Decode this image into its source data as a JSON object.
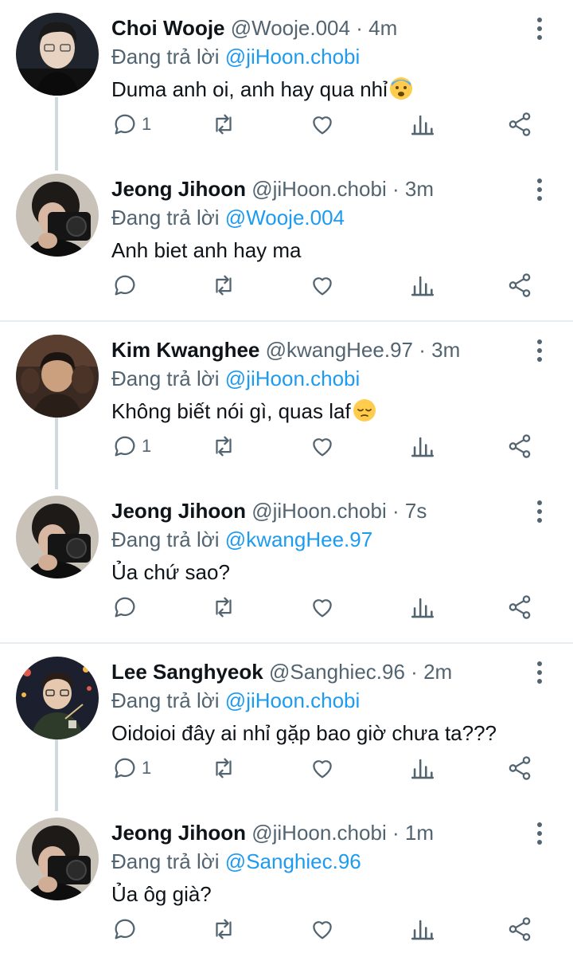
{
  "reply_prefix": "Đang trả lời",
  "separator": "·",
  "colors": {
    "accent": "#1d9bf0",
    "muted": "#536471",
    "text": "#0f1419",
    "thread_line": "#cfd9de"
  },
  "tweets": [
    {
      "name": "Choi Wooje",
      "handle": "@Wooje.004",
      "time": "4m",
      "reply_to": "@jiHoon.chobi",
      "text": "Duma anh oi, anh hay qua nhỉ",
      "emoji": "fearful-face-emoji",
      "reply_count": "1"
    },
    {
      "name": "Jeong Jihoon",
      "handle": "@jiHoon.chobi",
      "time": "3m",
      "reply_to": "@Wooje.004",
      "text": "Anh biet anh hay ma",
      "reply_count": ""
    },
    {
      "name": "Kim Kwanghee",
      "handle": "@kwangHee.97",
      "time": "3m",
      "reply_to": "@jiHoon.chobi",
      "text": "Không biết nói gì, quas laf",
      "emoji": "pensive-face-emoji",
      "reply_count": "1"
    },
    {
      "name": "Jeong Jihoon",
      "handle": "@jiHoon.chobi",
      "time": "7s",
      "reply_to": "@kwangHee.97",
      "text": "Ủa chứ sao?",
      "reply_count": ""
    },
    {
      "name": "Lee Sanghyeok",
      "handle": "@Sanghiec.96",
      "time": "2m",
      "reply_to": "@jiHoon.chobi",
      "text": "Oidoioi đây ai nhỉ gặp bao giờ chưa ta???",
      "reply_count": "1"
    },
    {
      "name": "Jeong Jihoon",
      "handle": "@jiHoon.chobi",
      "time": "1m",
      "reply_to": "@Sanghiec.96",
      "text": "Ủa ôg già?",
      "reply_count": ""
    }
  ],
  "icons": [
    "reply-icon",
    "retweet-icon",
    "like-icon",
    "analytics-icon",
    "share-icon",
    "more-options-icon"
  ]
}
